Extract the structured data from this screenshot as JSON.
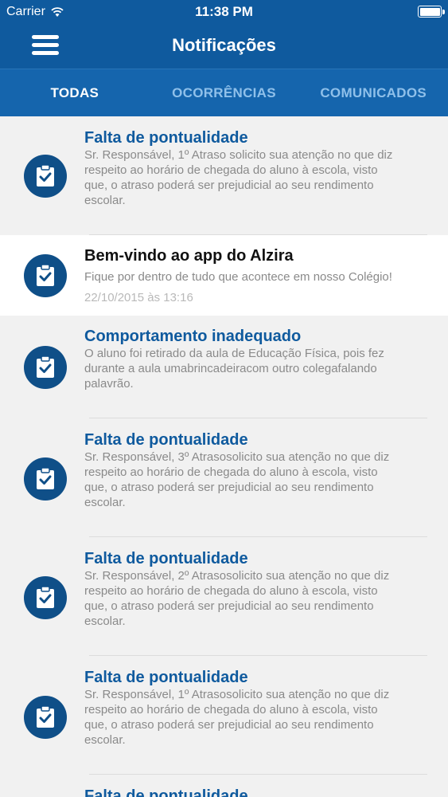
{
  "status_bar": {
    "carrier": "Carrier",
    "time": "11:38 PM"
  },
  "nav": {
    "title": "Notificações"
  },
  "tabs": [
    {
      "label": "TODAS",
      "active": true
    },
    {
      "label": "OCORRÊNCIAS",
      "active": false
    },
    {
      "label": "COMUNICADOS",
      "active": false
    }
  ],
  "notifications": [
    {
      "title": "Falta de pontualidade",
      "lines": [
        "Sr. Responsável, 1º Atraso solicito sua atenção no que diz",
        "respeito ao horário de chegada do aluno à escola, visto",
        "que, o atraso poderá ser prejudicial ao seu rendimento",
        "escolar."
      ],
      "date": ""
    },
    {
      "title": "Bem-vindo ao app do Alzira",
      "lines": [
        "Fique por dentro de tudo que acontece em nosso Colégio!"
      ],
      "date": "22/10/2015 às 13:16"
    },
    {
      "title": "Comportamento inadequado",
      "lines": [
        "O aluno foi retirado da aula de Educação Física, pois fez",
        "durante a aula umabrincadeiracom outro colegafalando",
        "palavrão."
      ],
      "date": ""
    },
    {
      "title": "Falta de pontualidade",
      "lines": [
        "Sr. Responsável, 3º Atrasosolicito sua atenção no que diz",
        "respeito ao horário de chegada do aluno à escola, visto",
        "que, o atraso poderá ser prejudicial ao seu rendimento",
        "escolar."
      ],
      "date": ""
    },
    {
      "title": "Falta de pontualidade",
      "lines": [
        "Sr. Responsável, 2º Atrasosolicito sua atenção no que diz",
        "respeito ao horário de chegada do aluno à escola, visto",
        "que, o atraso poderá ser prejudicial ao seu rendimento",
        "escolar."
      ],
      "date": ""
    },
    {
      "title": "Falta de pontualidade",
      "lines": [
        "Sr. Responsável, 1º Atrasosolicito sua atenção no que diz",
        "respeito ao horário de chegada do aluno à escola, visto",
        "que, o atraso poderá ser prejudicial ao seu rendimento",
        "escolar."
      ],
      "date": ""
    },
    {
      "title": "Falta de pontualidade",
      "lines": [],
      "date": ""
    }
  ],
  "colors": {
    "header": "#0f5a9e",
    "tabs": "#1565ad",
    "icon": "#0f4f88",
    "title": "#0f5a9e"
  },
  "icons": {
    "menu": "hamburger-icon",
    "item": "clipboard-check-icon",
    "wifi": "wifi-icon",
    "battery": "battery-icon"
  }
}
